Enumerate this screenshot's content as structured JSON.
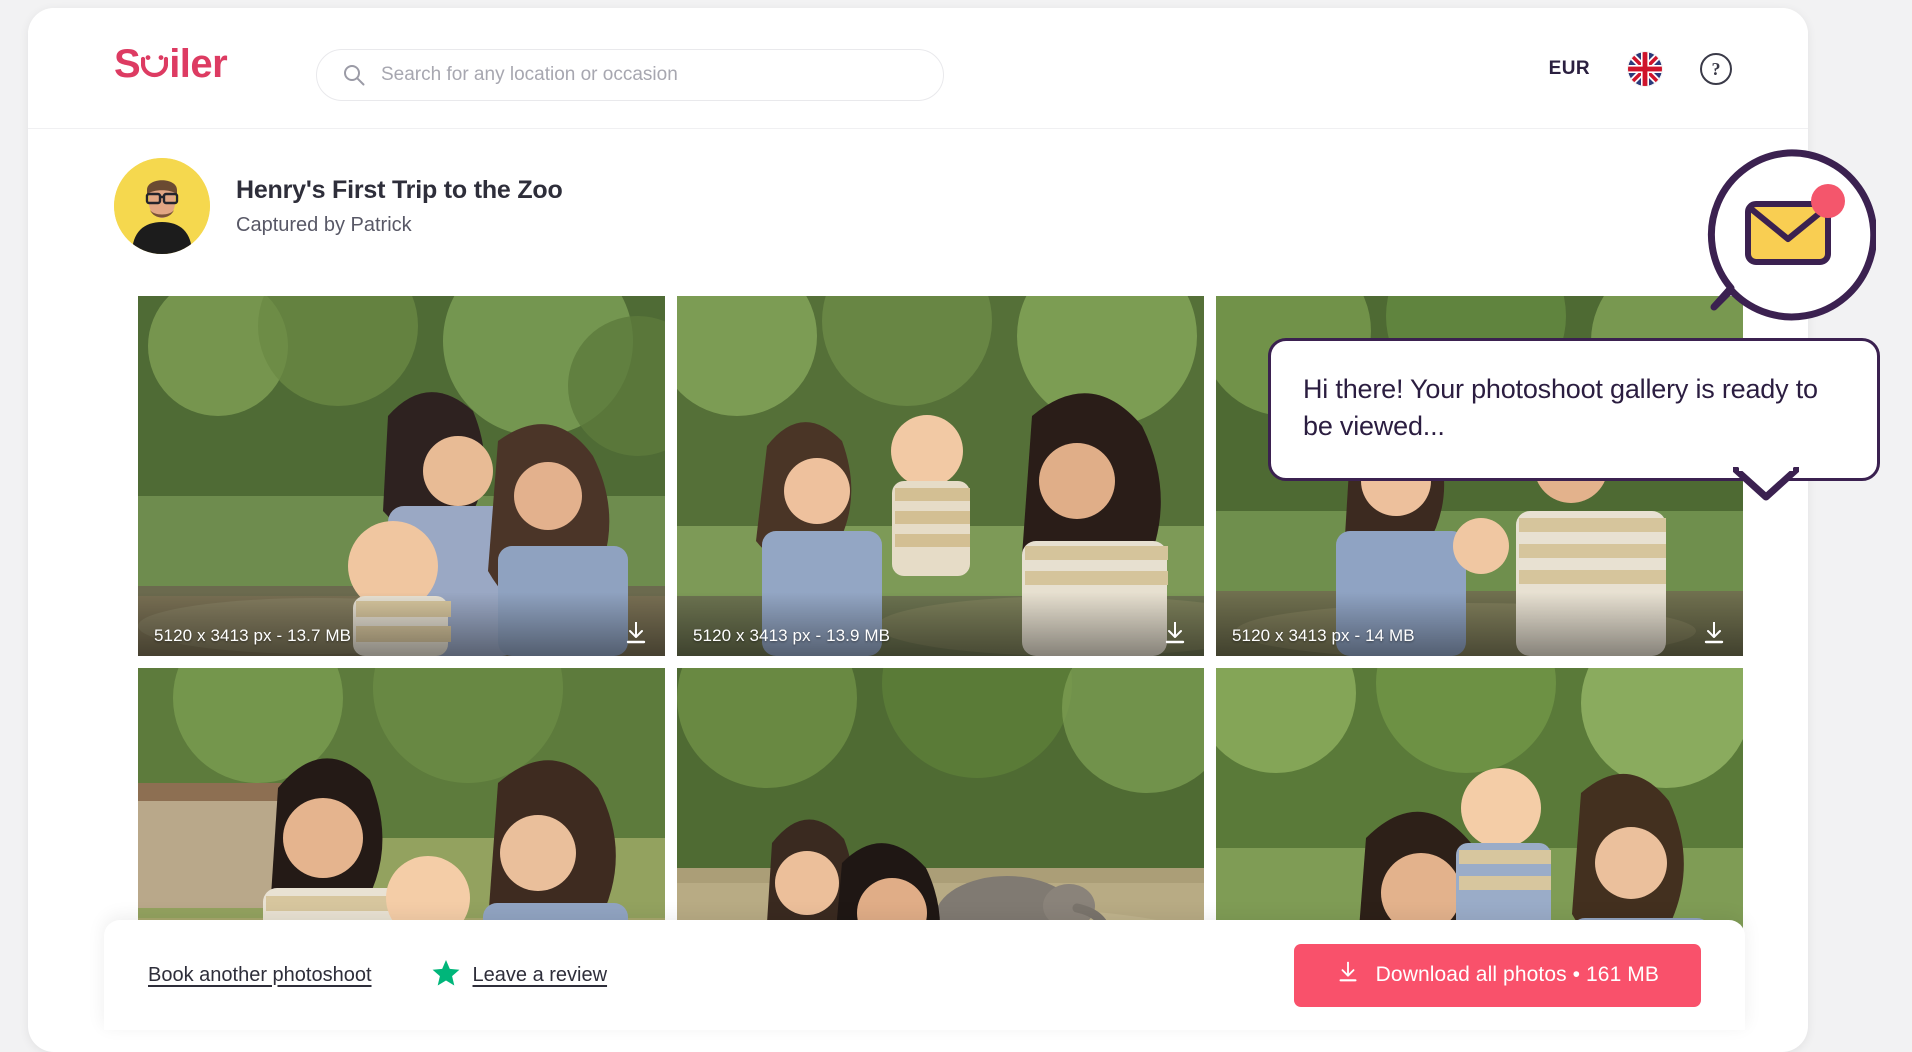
{
  "header": {
    "logo_text": "Smiler",
    "logo_color": "#dd3b62",
    "search": {
      "placeholder": "Search for any location or occasion",
      "value": ""
    },
    "currency": "EUR",
    "language_flag": "uk-flag-icon",
    "help_label": "?"
  },
  "gallery": {
    "title": "Henry's First Trip to the Zoo",
    "subtitle": "Captured by Patrick",
    "photos": [
      {
        "info": "5120 x 3413 px - 13.7 MB",
        "dimensions": "5120 x 3413 px",
        "size": "13.7 MB"
      },
      {
        "info": "5120 x 3413 px - 13.9 MB",
        "dimensions": "5120 x 3413 px",
        "size": "13.9 MB"
      },
      {
        "info": "5120 x 3413 px - 14 MB",
        "dimensions": "5120 x 3413 px",
        "size": "14 MB"
      },
      {
        "info": "",
        "dimensions": "",
        "size": ""
      },
      {
        "info": "",
        "dimensions": "",
        "size": ""
      },
      {
        "info": "",
        "dimensions": "",
        "size": ""
      }
    ]
  },
  "action_bar": {
    "book_link": "Book another photoshoot",
    "review_link": "Leave a review",
    "download_all": "Download all photos • 161 MB",
    "download_button_color": "#f9516b",
    "star_color": "#00b67a"
  },
  "chat": {
    "message": "Hi there! Your photoshoot gallery is ready to be viewed...",
    "bubble_border_color": "#3b2150",
    "envelope_color": "#f9ce52",
    "badge_color": "#f4566c",
    "has_unread": true
  }
}
